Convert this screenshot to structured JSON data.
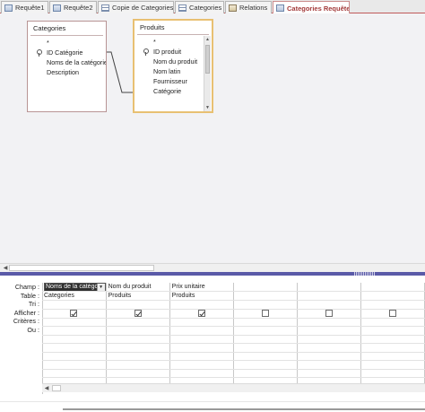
{
  "tabs": [
    {
      "label": "Requête1",
      "icon": "query-icon",
      "active": false
    },
    {
      "label": "Requête2",
      "icon": "query-icon",
      "active": false
    },
    {
      "label": "Copie de Categories",
      "icon": "table-icon",
      "active": false
    },
    {
      "label": "Categories",
      "icon": "table-icon",
      "active": false
    },
    {
      "label": "Relations",
      "icon": "relations-icon",
      "active": false
    },
    {
      "label": "Categories Requête",
      "icon": "query-icon",
      "active": true
    }
  ],
  "field_lists": {
    "categories": {
      "title": "Categories",
      "fields": [
        "*",
        "ID Catégorie",
        "Noms de la catégorie",
        "Description"
      ],
      "key_field": "ID Catégorie"
    },
    "produits": {
      "title": "Produits",
      "fields": [
        "*",
        "ID produit",
        "Nom du produit",
        "Nom latin",
        "Fournisseur",
        "Catégorie"
      ],
      "key_field": "ID produit",
      "selected": true
    }
  },
  "grid": {
    "row_labels": {
      "champ": "Champ :",
      "table": "Table :",
      "tri": "Tri :",
      "afficher": "Afficher :",
      "criteres": "Critères :",
      "ou": "Ou :"
    },
    "columns": [
      {
        "champ": "Noms de la catégorie",
        "table": "Categories",
        "afficher": true,
        "active": true
      },
      {
        "champ": "Nom du produit",
        "table": "Produits",
        "afficher": true
      },
      {
        "champ": "Prix unitaire",
        "table": "Produits",
        "afficher": true
      },
      {
        "champ": "",
        "table": "",
        "afficher": false
      },
      {
        "champ": "",
        "table": "",
        "afficher": false
      },
      {
        "champ": "",
        "table": "",
        "afficher": false
      }
    ]
  },
  "colors": {
    "active_tab_text": "#a33b3b",
    "selected_table_border": "#e8c072",
    "splitter": "#5a5aa8"
  }
}
